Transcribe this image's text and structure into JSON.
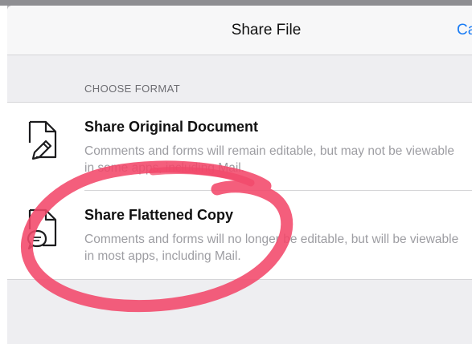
{
  "navbar": {
    "title": "Share File",
    "cancel_label": "Ca"
  },
  "section": {
    "header": "CHOOSE FORMAT"
  },
  "options": [
    {
      "title": "Share Original Document",
      "description_line1": "Comments and forms will remain editable, but may not be viewable",
      "description_line2": "in some apps, including Mail.",
      "icon": "document-pen-icon"
    },
    {
      "title": "Share Flattened Copy",
      "description_line1": "Comments and forms will no longer be editable, but will be viewable",
      "description_line2": "in most apps, including Mail.",
      "icon": "document-comment-icon"
    }
  ],
  "colors": {
    "accent": "#1a7cf4",
    "annotation": "#f2486a"
  }
}
